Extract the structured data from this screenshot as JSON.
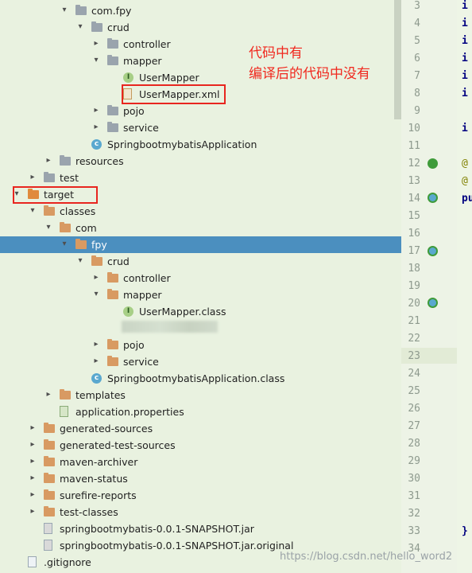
{
  "tree": [
    {
      "label": "com.fpy",
      "indent": 95,
      "arrow": "open",
      "icon": "folder-gray"
    },
    {
      "label": "crud",
      "indent": 115,
      "arrow": "open",
      "icon": "folder-gray"
    },
    {
      "label": "controller",
      "indent": 135,
      "arrow": "closed",
      "icon": "folder-gray"
    },
    {
      "label": "mapper",
      "indent": 135,
      "arrow": "open",
      "icon": "folder-gray"
    },
    {
      "label": "UserMapper",
      "indent": 155,
      "arrow": "none",
      "icon": "interface"
    },
    {
      "label": "UserMapper.xml",
      "indent": 155,
      "arrow": "none",
      "icon": "xml"
    },
    {
      "label": "pojo",
      "indent": 135,
      "arrow": "closed",
      "icon": "folder-gray"
    },
    {
      "label": "service",
      "indent": 135,
      "arrow": "closed",
      "icon": "folder-gray"
    },
    {
      "label": "SpringbootmybatisApplication",
      "indent": 115,
      "arrow": "none",
      "icon": "class"
    },
    {
      "label": "resources",
      "indent": 75,
      "arrow": "closed",
      "icon": "folder-gray"
    },
    {
      "label": "test",
      "indent": 55,
      "arrow": "closed",
      "icon": "folder-gray"
    },
    {
      "label": "target",
      "indent": 35,
      "arrow": "open",
      "icon": "folder-orange"
    },
    {
      "label": "classes",
      "indent": 55,
      "arrow": "open",
      "icon": "folder"
    },
    {
      "label": "com",
      "indent": 75,
      "arrow": "open",
      "icon": "folder"
    },
    {
      "label": "fpy",
      "indent": 95,
      "arrow": "open",
      "icon": "folder",
      "selected": true
    },
    {
      "label": "crud",
      "indent": 115,
      "arrow": "open",
      "icon": "folder"
    },
    {
      "label": "controller",
      "indent": 135,
      "arrow": "closed",
      "icon": "folder"
    },
    {
      "label": "mapper",
      "indent": 135,
      "arrow": "open",
      "icon": "folder"
    },
    {
      "label": "UserMapper.class",
      "indent": 155,
      "arrow": "none",
      "icon": "interface"
    },
    {
      "label": "",
      "indent": 155,
      "arrow": "none",
      "icon": "none"
    },
    {
      "label": "pojo",
      "indent": 135,
      "arrow": "closed",
      "icon": "folder"
    },
    {
      "label": "service",
      "indent": 135,
      "arrow": "closed",
      "icon": "folder"
    },
    {
      "label": "SpringbootmybatisApplication.class",
      "indent": 115,
      "arrow": "none",
      "icon": "class"
    },
    {
      "label": "templates",
      "indent": 75,
      "arrow": "closed",
      "icon": "folder"
    },
    {
      "label": "application.properties",
      "indent": 75,
      "arrow": "none",
      "icon": "props"
    },
    {
      "label": "generated-sources",
      "indent": 55,
      "arrow": "closed",
      "icon": "folder"
    },
    {
      "label": "generated-test-sources",
      "indent": 55,
      "arrow": "closed",
      "icon": "folder"
    },
    {
      "label": "maven-archiver",
      "indent": 55,
      "arrow": "closed",
      "icon": "folder"
    },
    {
      "label": "maven-status",
      "indent": 55,
      "arrow": "closed",
      "icon": "folder"
    },
    {
      "label": "surefire-reports",
      "indent": 55,
      "arrow": "closed",
      "icon": "folder"
    },
    {
      "label": "test-classes",
      "indent": 55,
      "arrow": "closed",
      "icon": "folder"
    },
    {
      "label": "springbootmybatis-0.0.1-SNAPSHOT.jar",
      "indent": 55,
      "arrow": "none",
      "icon": "jar"
    },
    {
      "label": "springbootmybatis-0.0.1-SNAPSHOT.jar.original",
      "indent": 55,
      "arrow": "none",
      "icon": "jar"
    },
    {
      "label": ".gitignore",
      "indent": 35,
      "arrow": "none",
      "icon": "file"
    }
  ],
  "annotation": {
    "line1": "代码中有",
    "line2": "编译后的代码中没有"
  },
  "line_numbers": [
    "3",
    "4",
    "5",
    "6",
    "7",
    "8",
    "9",
    "10",
    "11",
    "12",
    "13",
    "14",
    "15",
    "16",
    "17",
    "18",
    "19",
    "20",
    "21",
    "22",
    "23",
    "24",
    "25",
    "26",
    "27",
    "28",
    "29",
    "30",
    "31",
    "32",
    "33",
    "34"
  ],
  "code_fragments": [
    {
      "line": "3",
      "text": "i"
    },
    {
      "line": "4",
      "text": "i"
    },
    {
      "line": "5",
      "text": "i"
    },
    {
      "line": "6",
      "text": "i"
    },
    {
      "line": "7",
      "text": "i"
    },
    {
      "line": "8",
      "text": "i"
    },
    {
      "line": "10",
      "text": "i"
    },
    {
      "line": "12",
      "text": "@",
      "kind": "annotation"
    },
    {
      "line": "13",
      "text": "@",
      "kind": "annotation"
    },
    {
      "line": "14",
      "text": "pu"
    },
    {
      "line": "33",
      "text": "}"
    }
  ],
  "watermark": "https://blog.csdn.net/hello_word2",
  "colors": {
    "selection": "#4b8fbf",
    "highlight_box": "#e8261f",
    "annotation_text": "#f0281e",
    "folder": "#d89a62"
  }
}
